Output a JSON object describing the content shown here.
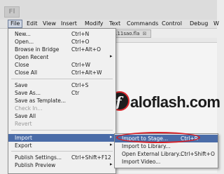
{
  "app": {
    "logo_text": "Fl"
  },
  "menubar": [
    "File",
    "Edit",
    "View",
    "Insert",
    "Modify",
    "Text",
    "Commands",
    "Control",
    "Debug",
    "W"
  ],
  "document": {
    "tab_label": "111sao.fla",
    "close_glyph": "⊠"
  },
  "watermark": {
    "text": "aloflash.com",
    "logo_letter": "f"
  },
  "file_menu": [
    {
      "label": "New...",
      "shortcut": "Ctrl+N"
    },
    {
      "label": "Open...",
      "shortcut": "Ctrl+O"
    },
    {
      "label": "Browse in Bridge",
      "shortcut": "Ctrl+Alt+O"
    },
    {
      "label": "Open Recent",
      "shortcut": "",
      "submenu": true
    },
    {
      "label": "Close",
      "shortcut": "Ctrl+W"
    },
    {
      "label": "Close All",
      "shortcut": "Ctrl+Alt+W"
    },
    {
      "label": "Save",
      "shortcut": "Ctrl+S"
    },
    {
      "label": "Save As...",
      "shortcut": "Ctr"
    },
    {
      "label": "Save as Template...",
      "shortcut": ""
    },
    {
      "label": "Check In...",
      "shortcut": "",
      "disabled": true
    },
    {
      "label": "Save All",
      "shortcut": ""
    },
    {
      "label": "Revert",
      "shortcut": "",
      "disabled": true
    },
    {
      "label": "Import",
      "shortcut": "",
      "submenu": true,
      "highlight": true
    },
    {
      "label": "Export",
      "shortcut": "",
      "submenu": true
    },
    {
      "label": "Publish Settings...",
      "shortcut": "Ctrl+Shift+F12"
    },
    {
      "label": "Publish Preview",
      "shortcut": "",
      "submenu": true
    }
  ],
  "import_submenu": [
    {
      "label": "Import to Stage...",
      "shortcut": "Ctrl+R",
      "highlight": true
    },
    {
      "label": "Import to Library...",
      "shortcut": ""
    },
    {
      "label": "Open External Library...",
      "shortcut": "Ctrl+Shift+O"
    },
    {
      "label": "Import Video...",
      "shortcut": ""
    }
  ]
}
